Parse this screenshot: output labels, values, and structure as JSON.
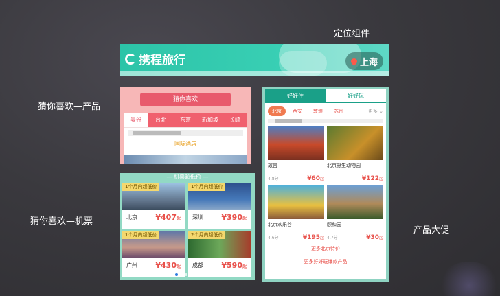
{
  "labels": {
    "location": "定位组件",
    "guess_product": "猜你喜欢—产品",
    "guess_flight": "猜你喜欢—机票",
    "promo": "产品大促"
  },
  "banner": {
    "logo": "携程旅行",
    "city": "上海",
    "icons": [
      "location-pin-icon"
    ]
  },
  "guess_product": {
    "ribbon": "猜你喜欢",
    "tabs": [
      "曼谷",
      "台北",
      "东京",
      "新加坡",
      "长崎"
    ],
    "section": "国际酒店",
    "colors": {
      "accent": "#e85a6c",
      "bg": "#f7b7b7"
    }
  },
  "flights": {
    "header": "— 机票超低价 —",
    "cells": [
      {
        "tag": "1个月内超低价",
        "city": "北京",
        "price": "¥407",
        "unit": "起"
      },
      {
        "tag": "1个月内超低价",
        "city": "深圳",
        "price": "¥390",
        "unit": "起"
      },
      {
        "tag": "1个月内超低价",
        "city": "广州",
        "price": "¥430",
        "unit": "起"
      },
      {
        "tag": "2个月内超低价",
        "city": "成都",
        "price": "¥590",
        "unit": "起"
      }
    ]
  },
  "promo": {
    "tabs": [
      "好好住",
      "好好玩"
    ],
    "cities": [
      "北京",
      "西安",
      "敦煌",
      "苏州"
    ],
    "more": "更多",
    "items": [
      {
        "name": "故宫",
        "score": "4.8分",
        "price": "¥60",
        "unit": "起"
      },
      {
        "name": "北京野生动物园",
        "score": "",
        "price": "¥122",
        "unit": "起"
      },
      {
        "name": "北京欢乐谷",
        "score": "4.6分",
        "price": "¥195",
        "unit": "起"
      },
      {
        "name": "颐和园",
        "score": "4.7分",
        "price": "¥30",
        "unit": "起"
      }
    ],
    "link_more_city": "更多北京特价",
    "link_more_all": "更多好好玩爆款产品",
    "colors": {
      "accent": "#1aa088",
      "price": "#e8504a"
    }
  }
}
